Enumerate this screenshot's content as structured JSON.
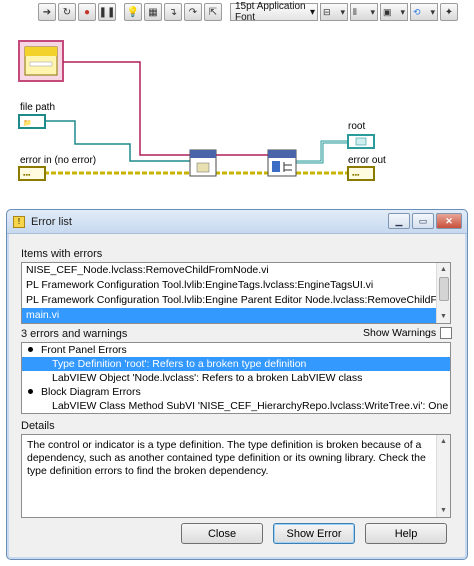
{
  "toolbar": {
    "font_label": "15pt Application Font",
    "icons": [
      "run-arrow-icon",
      "highlight-icon",
      "pause-icon",
      "retain-wire-icon",
      "step-into-icon",
      "step-over-icon",
      "step-out-icon",
      "font-icon",
      "align-icon",
      "distribute-icon",
      "reorder-icon",
      "cleanup-icon"
    ]
  },
  "diagram": {
    "labels": {
      "file_path": "file path",
      "error_in": "error in (no error)",
      "root": "root",
      "error_out": "error out"
    },
    "colors": {
      "error_wire": "#c8b400",
      "path_wire": "#1f8a8a",
      "class_wire": "#b01e5a",
      "tree_wire": "#4a6cc9"
    }
  },
  "dialog": {
    "title": "Error list",
    "items_label": "Items with errors",
    "items": [
      "NISE_CEF_Node.lvclass:RemoveChildFromNode.vi",
      "PL Framework Configuration Tool.lvlib:EngineTags.lvclass:EngineTagsUI.vi",
      "PL Framework Configuration Tool.lvlib:Engine Parent Editor Node.lvclass:RemoveChildFror",
      "main.vi"
    ],
    "selected_item_index": 3,
    "warnings_label": "3 errors and warnings",
    "show_warnings_label": "Show Warnings",
    "show_warnings_checked": false,
    "tree": [
      {
        "text": "Front Panel Errors",
        "level": 0,
        "bullet": true
      },
      {
        "text": "Type Definition 'root': Refers to a broken type definition",
        "level": 1,
        "selected": true
      },
      {
        "text": "LabVIEW Object 'Node.lvclass': Refers to a broken LabVIEW class",
        "level": 1
      },
      {
        "text": "Block Diagram Errors",
        "level": 0,
        "bullet": true
      },
      {
        "text": "LabVIEW Class Method SubVI 'NISE_CEF_HierarchyRepo.lvclass:WriteTree.vi': One or mor",
        "level": 1
      }
    ],
    "details_label": "Details",
    "details_text": "The control or indicator is a type definition. The type definition is broken because of a dependency, such as another contained type definition or its owning library. Check the type definition errors to find the broken dependency.",
    "buttons": {
      "close": "Close",
      "show_error": "Show Error",
      "help": "Help"
    }
  }
}
